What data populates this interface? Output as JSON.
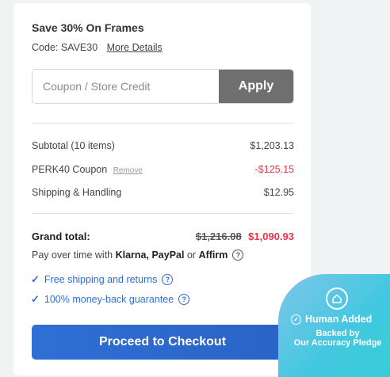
{
  "promo": {
    "title": "Save 30% On Frames",
    "code_label": "Code: SAVE30",
    "more_details": "More Details"
  },
  "coupon": {
    "placeholder": "Coupon / Store Credit",
    "apply_label": "Apply"
  },
  "summary": {
    "subtotal_label": "Subtotal (10 items)",
    "subtotal_value": "$1,203.13",
    "coupon_label": "PERK40 Coupon",
    "coupon_remove": "Remove",
    "coupon_value": "-$125.15",
    "shipping_label": "Shipping & Handling",
    "shipping_value": "$12.95"
  },
  "grand": {
    "label": "Grand total:",
    "old_price": "$1,216.08",
    "new_price": "$1,090.93"
  },
  "payover": {
    "prefix": "Pay over time with",
    "brands": "Klarna, PayPal",
    "or": "or",
    "brand_last": "Affirm"
  },
  "benefits": [
    {
      "label": "Free shipping and returns"
    },
    {
      "label": "100% money-back guarantee"
    }
  ],
  "checkout_label": "Proceed to Checkout",
  "badge": {
    "title": "Human Added",
    "line1": "Backed by",
    "line2": "Our Accuracy Pledge"
  },
  "colors": {
    "accent_blue": "#2e6fd6",
    "discount_red": "#e8344b",
    "apply_gray": "#6f6f6f",
    "badge_teal": "#43c7e0"
  }
}
